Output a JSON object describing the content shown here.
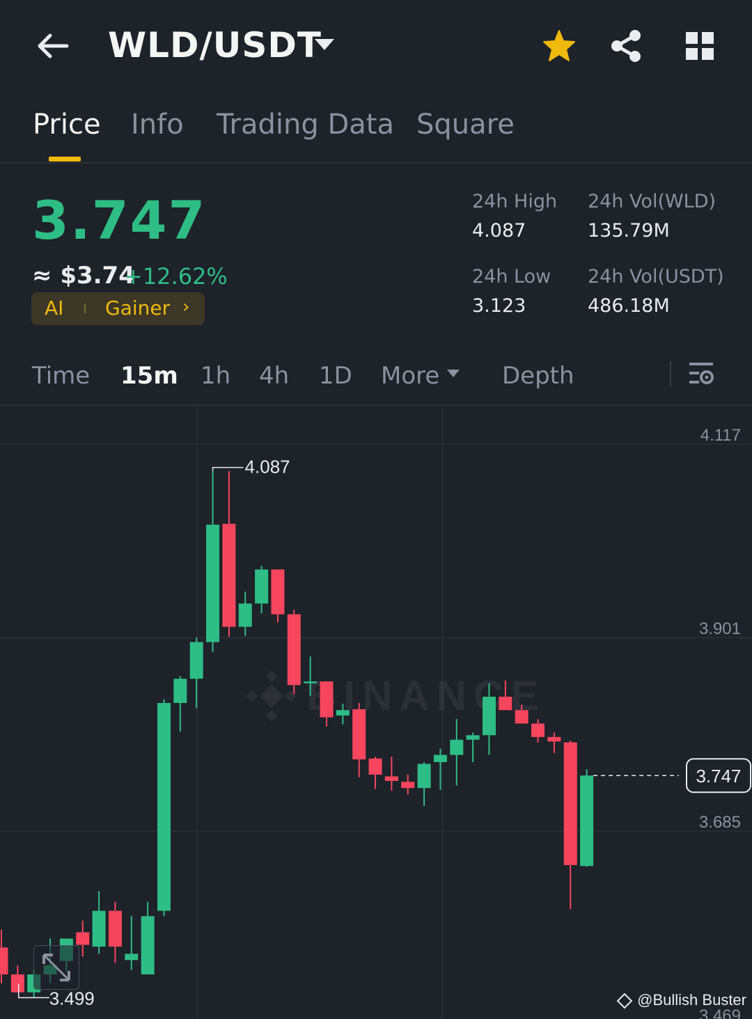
{
  "header": {
    "pair": "WLD/USDT",
    "back_icon": "arrow-left-icon",
    "favorite_icon": "star-icon",
    "share_icon": "share-icon",
    "menu_icon": "grid-icon",
    "favorite_color": "#f0b90b"
  },
  "tabs": [
    {
      "label": "Price",
      "active": true
    },
    {
      "label": "Info",
      "active": false
    },
    {
      "label": "Trading Data",
      "active": false
    },
    {
      "label": "Square",
      "active": false
    }
  ],
  "ticker": {
    "last_price": "3.747",
    "fiat_price": "≈ $3.74",
    "change_pct": "+12.62%",
    "tag_ai": "AI",
    "tag_gainer": "Gainer",
    "high_label": "24h High",
    "high_value": "4.087",
    "low_label": "24h Low",
    "low_value": "3.123",
    "vol_base_label": "24h Vol(WLD)",
    "vol_base_value": "135.79M",
    "vol_quote_label": "24h Vol(USDT)",
    "vol_quote_value": "486.18M",
    "up_color": "#2ebd85",
    "down_color": "#f6465d"
  },
  "intervals": [
    {
      "label": "Time",
      "active": false
    },
    {
      "label": "15m",
      "active": true
    },
    {
      "label": "1h",
      "active": false
    },
    {
      "label": "4h",
      "active": false
    },
    {
      "label": "1D",
      "active": false
    },
    {
      "label": "More",
      "active": false
    },
    {
      "label": "Depth",
      "active": false
    }
  ],
  "chart_settings_icon": "chart-settings-icon",
  "expand_icon": "expand-icon",
  "watermark": "@Bullish Buster",
  "chart_data": {
    "type": "candlestick",
    "title": "",
    "y_ticks": [
      4.117,
      3.901,
      3.685,
      3.469
    ],
    "ylim": [
      3.469,
      4.117
    ],
    "current_price": 3.747,
    "max_marker": 4.087,
    "min_marker": 3.499,
    "candles": [
      {
        "o": 3.555,
        "h": 3.575,
        "l": 3.515,
        "c": 3.525
      },
      {
        "o": 3.525,
        "h": 3.535,
        "l": 3.505,
        "c": 3.505
      },
      {
        "o": 3.505,
        "h": 3.53,
        "l": 3.499,
        "c": 3.525
      },
      {
        "o": 3.525,
        "h": 3.565,
        "l": 3.515,
        "c": 3.535
      },
      {
        "o": 3.54,
        "h": 3.565,
        "l": 3.528,
        "c": 3.565
      },
      {
        "o": 3.572,
        "h": 3.585,
        "l": 3.545,
        "c": 3.558
      },
      {
        "o": 3.556,
        "h": 3.618,
        "l": 3.548,
        "c": 3.596
      },
      {
        "o": 3.596,
        "h": 3.606,
        "l": 3.538,
        "c": 3.556
      },
      {
        "o": 3.541,
        "h": 3.59,
        "l": 3.53,
        "c": 3.548
      },
      {
        "o": 3.525,
        "h": 3.606,
        "l": 3.525,
        "c": 3.59
      },
      {
        "o": 3.596,
        "h": 3.832,
        "l": 3.59,
        "c": 3.828
      },
      {
        "o": 3.828,
        "h": 3.858,
        "l": 3.796,
        "c": 3.855
      },
      {
        "o": 3.855,
        "h": 3.901,
        "l": 3.822,
        "c": 3.896
      },
      {
        "o": 3.896,
        "h": 4.087,
        "l": 3.885,
        "c": 4.027
      },
      {
        "o": 4.028,
        "h": 4.087,
        "l": 3.902,
        "c": 3.913
      },
      {
        "o": 3.913,
        "h": 3.952,
        "l": 3.903,
        "c": 3.939
      },
      {
        "o": 3.939,
        "h": 3.981,
        "l": 3.928,
        "c": 3.977
      },
      {
        "o": 3.977,
        "h": 3.973,
        "l": 3.918,
        "c": 3.927
      },
      {
        "o": 3.927,
        "h": 3.932,
        "l": 3.838,
        "c": 3.848
      },
      {
        "o": 3.85,
        "h": 3.88,
        "l": 3.836,
        "c": 3.852
      },
      {
        "o": 3.852,
        "h": 3.852,
        "l": 3.802,
        "c": 3.812
      },
      {
        "o": 3.814,
        "h": 3.827,
        "l": 3.804,
        "c": 3.82
      },
      {
        "o": 3.821,
        "h": 3.828,
        "l": 3.745,
        "c": 3.765
      },
      {
        "o": 3.766,
        "h": 3.768,
        "l": 3.732,
        "c": 3.748
      },
      {
        "o": 3.746,
        "h": 3.768,
        "l": 3.73,
        "c": 3.741
      },
      {
        "o": 3.74,
        "h": 3.748,
        "l": 3.726,
        "c": 3.733
      },
      {
        "o": 3.733,
        "h": 3.762,
        "l": 3.713,
        "c": 3.76
      },
      {
        "o": 3.762,
        "h": 3.777,
        "l": 3.731,
        "c": 3.77
      },
      {
        "o": 3.77,
        "h": 3.81,
        "l": 3.736,
        "c": 3.787
      },
      {
        "o": 3.787,
        "h": 3.795,
        "l": 3.762,
        "c": 3.792
      },
      {
        "o": 3.792,
        "h": 3.85,
        "l": 3.77,
        "c": 3.835
      },
      {
        "o": 3.835,
        "h": 3.853,
        "l": 3.827,
        "c": 3.82
      },
      {
        "o": 3.82,
        "h": 3.826,
        "l": 3.807,
        "c": 3.805
      },
      {
        "o": 3.805,
        "h": 3.81,
        "l": 3.784,
        "c": 3.79
      },
      {
        "o": 3.79,
        "h": 3.795,
        "l": 3.772,
        "c": 3.785
      },
      {
        "o": 3.784,
        "h": 3.786,
        "l": 3.598,
        "c": 3.647
      },
      {
        "o": 3.646,
        "h": 3.754,
        "l": 3.645,
        "c": 3.747
      }
    ]
  }
}
